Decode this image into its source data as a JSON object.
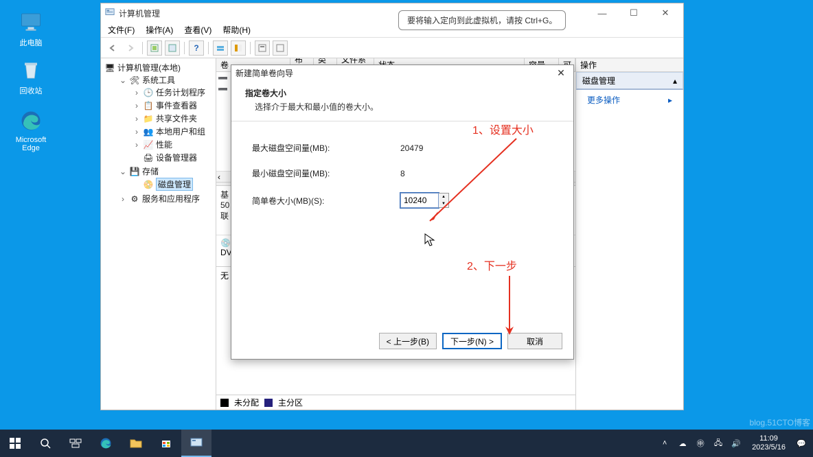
{
  "desktop": {
    "this_pc": "此电脑",
    "recycle": "回收站",
    "edge": "Microsoft Edge"
  },
  "vm_hint": "要将输入定向到此虚拟机，请按 Ctrl+G。",
  "mgmt": {
    "title": "计算机管理",
    "menu": [
      "文件(F)",
      "操作(A)",
      "查看(V)",
      "帮助(H)"
    ],
    "tree": {
      "root": "计算机管理(本地)",
      "sys_tools": "系统工具",
      "task_sched": "任务计划程序",
      "event_viewer": "事件查看器",
      "shared": "共享文件夹",
      "local_users": "本地用户和组",
      "perf": "性能",
      "dev_mgr": "设备管理器",
      "storage": "存储",
      "disk_mgmt": "磁盘管理",
      "services": "服务和应用程序"
    },
    "cols": {
      "vol": "卷",
      "layout": "布局",
      "type": "类型",
      "fs": "文件系统",
      "status": "状态",
      "cap": "容量",
      "avail": "可"
    },
    "disk": {
      "basic_label": "基",
      "size_line": "50",
      "online": "联"
    },
    "cd": "DV",
    "una": "无",
    "legend": {
      "unalloc": "未分配",
      "primary": "主分区"
    },
    "actions": {
      "title": "操作",
      "section": "磁盘管理",
      "more": "更多操作"
    }
  },
  "wizard": {
    "title": "新建简单卷向导",
    "head_h1": "指定卷大小",
    "head_h2": "选择介于最大和最小值的卷大小。",
    "max_label": "最大磁盘空间量(MB):",
    "max_val": "20479",
    "min_label": "最小磁盘空间量(MB):",
    "min_val": "8",
    "size_label": "简单卷大小(MB)(S):",
    "size_val": "10240",
    "back": "< 上一步(B)",
    "next": "下一步(N) >",
    "cancel": "取消"
  },
  "anno": {
    "a1": "1、设置大小",
    "a2": "2、下一步"
  },
  "taskbar": {
    "time": "11:09",
    "date": "2023/5/16"
  },
  "watermark": "blog.51CTO博客"
}
